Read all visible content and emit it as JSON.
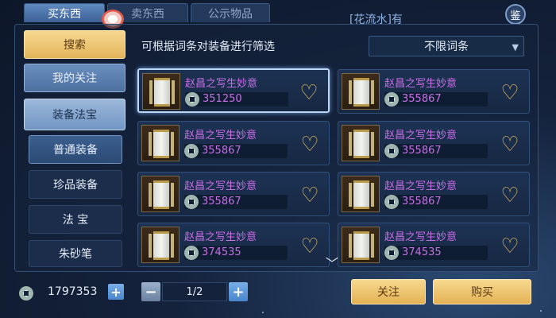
{
  "top_tabs": [
    "买东西",
    "卖东西",
    "公示物品"
  ],
  "announcement": "[花流水]有",
  "appraise_label": "鉴",
  "side_menu": {
    "search": "搜索",
    "my_follow": "我的关注",
    "equip_treasure": "装备法宝",
    "normal_equip": "普通装备",
    "rare_equip": "珍品装备",
    "fabao": "法 宝",
    "zhusha": "朱砂笔"
  },
  "filter": {
    "label": "可根据词条对装备进行筛选",
    "selected": "不限词条"
  },
  "items": [
    {
      "name": "赵昌之写生妙意",
      "price": "351250"
    },
    {
      "name": "赵昌之写生妙意",
      "price": "355867"
    },
    {
      "name": "赵昌之写生妙意",
      "price": "355867"
    },
    {
      "name": "赵昌之写生妙意",
      "price": "355867"
    },
    {
      "name": "赵昌之写生妙意",
      "price": "355867"
    },
    {
      "name": "赵昌之写生妙意",
      "price": "355867"
    },
    {
      "name": "赵昌之写生妙意",
      "price": "374535"
    },
    {
      "name": "赵昌之写生妙意",
      "price": "374535"
    }
  ],
  "wallet": {
    "amount": "1797353"
  },
  "pagination": {
    "current": "1/2"
  },
  "buttons": {
    "follow": "关注",
    "buy": "购买"
  },
  "colors": {
    "item_name": "#c86fe6",
    "gold_button": "#e4b154"
  }
}
